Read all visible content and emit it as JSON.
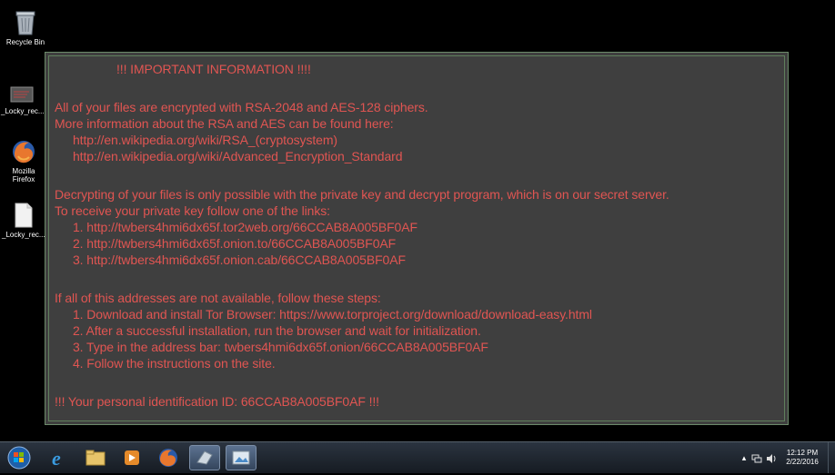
{
  "desktop": {
    "icons": [
      {
        "label": "Recycle Bin",
        "icon": "recycle-bin-icon"
      },
      {
        "label": "_Locky_rec...",
        "icon": "bitmap-file-icon"
      },
      {
        "label": "Mozilla Firefox",
        "icon": "firefox-icon"
      },
      {
        "label": "_Locky_rec...",
        "icon": "text-file-icon"
      }
    ]
  },
  "ransom_note": {
    "title": "!!! IMPORTANT INFORMATION !!!!",
    "lines": [
      "All of your files are encrypted with RSA-2048 and AES-128 ciphers.",
      "More information about the RSA and AES can be found here:",
      "http://en.wikipedia.org/wiki/RSA_(cryptosystem)",
      "http://en.wikipedia.org/wiki/Advanced_Encryption_Standard",
      "Decrypting of your files is only possible with the private key and decrypt program, which is on our secret server.",
      "To receive your private key follow one of the links:",
      "1. http://twbers4hmi6dx65f.tor2web.org/66CCAB8A005BF0AF",
      "2. http://twbers4hmi6dx65f.onion.to/66CCAB8A005BF0AF",
      "3. http://twbers4hmi6dx65f.onion.cab/66CCAB8A005BF0AF",
      "If all of this addresses are not available, follow these steps:",
      "1. Download and install Tor Browser: https://www.torproject.org/download/download-easy.html",
      "2. After a successful installation, run the browser and wait for initialization.",
      "3. Type in the address bar: twbers4hmi6dx65f.onion/66CCAB8A005BF0AF",
      "4. Follow the instructions on the site.",
      "!!! Your personal identification ID: 66CCAB8A005BF0AF !!!"
    ],
    "text_color": "#e05552",
    "background": "#3f3f3f"
  },
  "taskbar": {
    "buttons": [
      {
        "icon": "start-orb-icon"
      },
      {
        "icon": "internet-explorer-icon"
      },
      {
        "icon": "file-explorer-icon"
      },
      {
        "icon": "media-player-icon"
      },
      {
        "icon": "firefox-icon"
      },
      {
        "icon": "app-icon"
      },
      {
        "icon": "image-viewer-icon"
      }
    ],
    "clock": {
      "time": "12:12 PM",
      "date": "2/22/2016"
    }
  }
}
